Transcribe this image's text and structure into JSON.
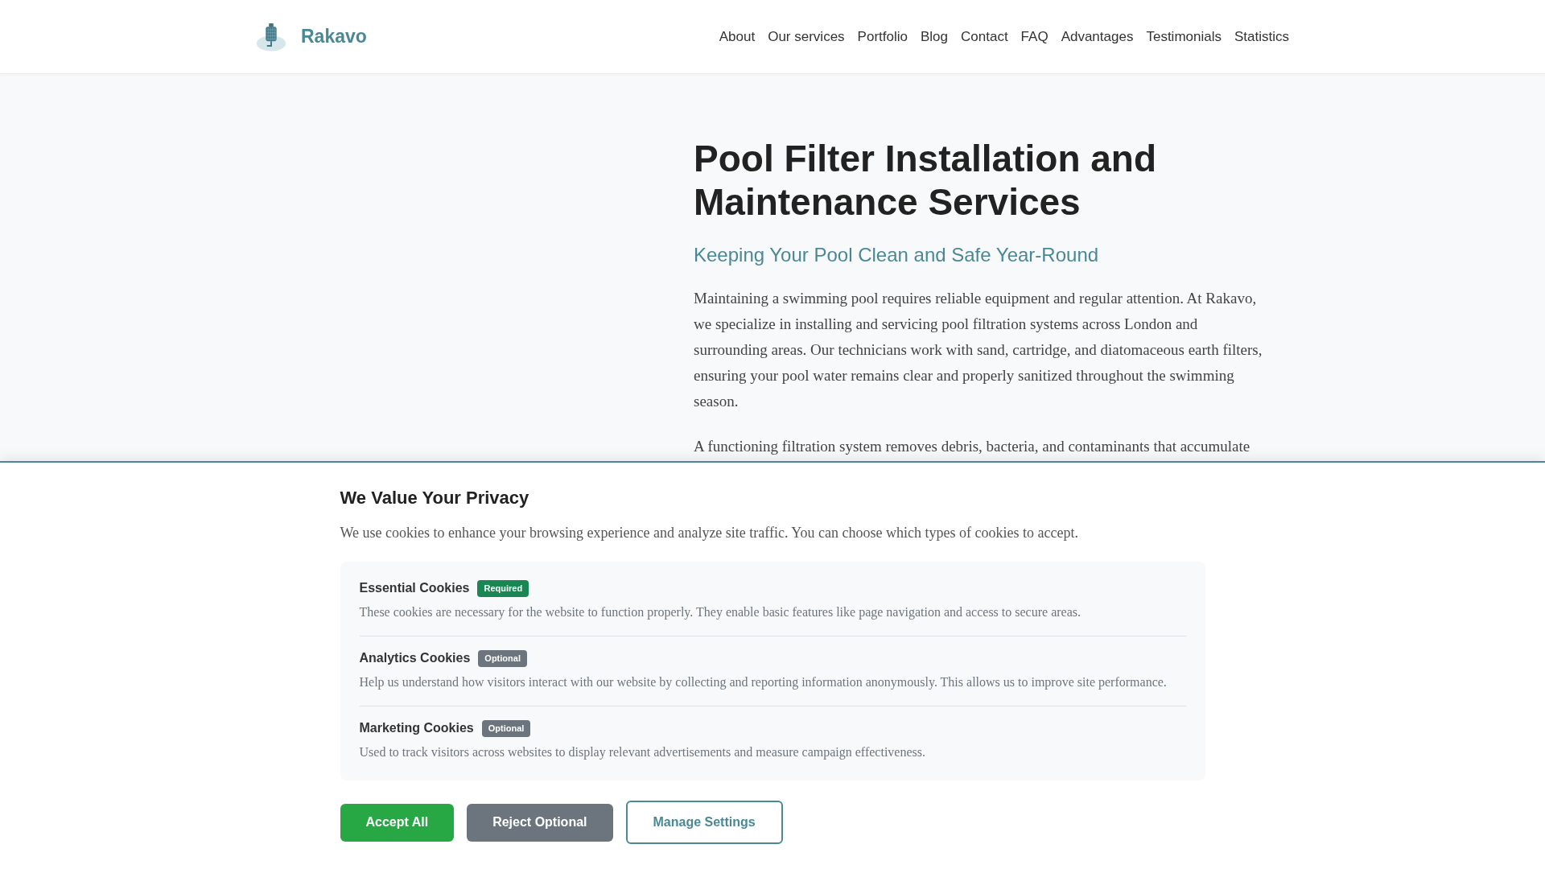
{
  "header": {
    "logo_text": "Rakavo",
    "nav": [
      "About",
      "Our services",
      "Portfolio",
      "Blog",
      "Contact",
      "FAQ",
      "Advantages",
      "Testimonials",
      "Statistics"
    ]
  },
  "hero": {
    "title": "Pool Filter Installation and Maintenance Services",
    "subtitle": "Keeping Your Pool Clean and Safe Year-Round",
    "paragraphs": [
      "Maintaining a swimming pool requires reliable equipment and regular attention. At Rakavo, we specialize in installing and servicing pool filtration systems across London and surrounding areas. Our technicians work with sand, cartridge, and diatomaceous earth filters, ensuring your pool water remains clear and properly sanitized throughout the swimming season.",
      "A functioning filtration system removes debris, bacteria, and contaminants that accumulate"
    ]
  },
  "cookie_banner": {
    "title": "We Value Your Privacy",
    "description": "We use cookies to enhance your browsing experience and analyze site traffic. You can choose which types of cookies to accept.",
    "categories": [
      {
        "name": "Essential Cookies",
        "badge": "Required",
        "color": "#198754",
        "description": "These cookies are necessary for the website to function properly. They enable basic features like page navigation and access to secure areas."
      },
      {
        "name": "Analytics Cookies",
        "badge": "Optional",
        "color": "#6c757d",
        "description": "Help us understand how visitors interact with our website by collecting and reporting information anonymously. This allows us to improve site performance."
      },
      {
        "name": "Marketing Cookies",
        "badge": "Optional",
        "color": "#6c757d",
        "description": "Used to track visitors across websites to display relevant advertisements and measure campaign effectiveness."
      }
    ],
    "buttons": [
      {
        "label": "Accept All",
        "kind": "primary"
      },
      {
        "label": "Reject Optional",
        "kind": "secondary"
      },
      {
        "label": "Manage Settings",
        "kind": "outline"
      }
    ]
  }
}
